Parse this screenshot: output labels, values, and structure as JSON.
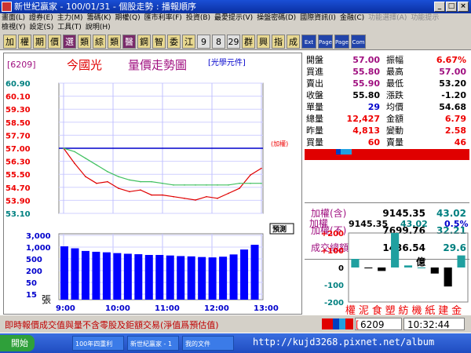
{
  "window": {
    "title": "新世紀贏家 - 100/01/31 - 個股走勢 : 播報順序"
  },
  "menu": {
    "row1": [
      "畫面(L)",
      "證券(E)",
      "主力(M)",
      "籌碼(K)",
      "期權(Q)",
      "匯市利率(F)",
      "投資(B)",
      "最愛提示(V)",
      "操盤密碼(D)",
      "國際資訊(I)",
      "金融(C)",
      "功能選擇(A)"
    ],
    "row1_disabled": [
      false,
      false,
      false,
      false,
      false,
      false,
      false,
      false,
      false,
      false,
      false,
      true
    ],
    "row1_extra": "功能提示",
    "row2": [
      "檢視(Y)",
      "設定(S)",
      "工具(T)",
      "說明(H)"
    ]
  },
  "toolbar": {
    "yellow": [
      "加",
      "權",
      "期",
      "價",
      "選",
      "類",
      "綜",
      "類",
      "醫",
      "鋼",
      "智",
      "委",
      "江"
    ],
    "numbers": [
      "9",
      "8",
      "29"
    ],
    "after_numbers": [
      "群",
      "興",
      "指",
      "成"
    ],
    "small": [
      "Ext",
      "Page Up",
      "Page Down",
      "Com"
    ]
  },
  "chart": {
    "code": "[6209]",
    "name": "今國光",
    "title": "量價走勢圖",
    "sector": "[光學元件]",
    "ref_label": "(加權)",
    "btn_label": "預測",
    "vol_unit": "張",
    "price_ticks": [
      "60.90",
      "60.10",
      "59.30",
      "58.50",
      "57.70",
      "57.00",
      "56.30",
      "55.50",
      "54.70",
      "53.90",
      "53.10"
    ],
    "vol_ticks": [
      "3,000",
      "1,000",
      "500",
      "200",
      "50",
      "15"
    ],
    "time_ticks": [
      "9:00",
      "10:00",
      "11:00",
      "12:00",
      "13:00"
    ],
    "colors": {
      "price": "#e00000",
      "avg": "#40c060",
      "ref": "#0000cc",
      "vol": "#0000ff"
    }
  },
  "chart_data": {
    "type": "line",
    "x": [
      "9:00",
      "9:15",
      "9:30",
      "9:45",
      "10:00",
      "10:15",
      "10:30",
      "10:45",
      "11:00",
      "11:15",
      "11:30",
      "11:45",
      "12:00",
      "12:15",
      "12:30",
      "12:45",
      "13:00",
      "13:15",
      "13:30"
    ],
    "series": [
      {
        "values": [
          57.0,
          56.1,
          55.3,
          54.9,
          55.0,
          54.6,
          54.4,
          54.5,
          54.2,
          54.2,
          54.1,
          54.0,
          53.9,
          54.1,
          54.0,
          54.3,
          54.6,
          55.4,
          55.8
        ]
      },
      {
        "values": [
          57.0,
          56.8,
          56.4,
          56.0,
          55.6,
          55.3,
          55.1,
          55.0,
          55.0,
          54.9,
          54.8,
          54.8,
          54.8,
          54.8,
          54.8,
          54.8,
          54.9,
          54.9,
          54.9
        ]
      }
    ],
    "volume": [
      900,
      700,
      500,
      450,
      420,
      380,
      350,
      330,
      300,
      300,
      280,
      260,
      250,
      230,
      220,
      240,
      320,
      600,
      1100
    ],
    "ref_price": 57.0
  },
  "quote": {
    "rows": [
      {
        "l1": "開盤",
        "v1": "57.00",
        "c1": "pur",
        "l2": "振幅",
        "v2": "6.67%",
        "c2": "red"
      },
      {
        "l1": "買進",
        "v1": "55.80",
        "c1": "pur",
        "l2": "最高",
        "v2": "57.00",
        "c2": "pur"
      },
      {
        "l1": "賣出",
        "v1": "55.90",
        "c1": "pur",
        "l2": "最低",
        "v2": "53.20",
        "c2": "blk"
      },
      {
        "l1": "收盤",
        "v1": "55.80",
        "c1": "blk",
        "l2": "漲跌",
        "v2": "-1.20",
        "c2": "blk"
      },
      {
        "l1": "單量",
        "v1": "29",
        "c1": "blu",
        "l2": "均價",
        "v2": "54.68",
        "c2": "blk"
      },
      {
        "l1": "總量",
        "v1": "12,427",
        "c1": "red",
        "l2": "金額",
        "v2": "6.79",
        "c2": "red"
      },
      {
        "l1": "昨量",
        "v1": "4,813",
        "c1": "red",
        "l2": "變動",
        "v2": "2.58",
        "c2": "red"
      },
      {
        "l1": "買量",
        "v1": "60",
        "c1": "red",
        "l2": "賣量",
        "v2": "46",
        "c2": "red"
      }
    ]
  },
  "index": {
    "rows": [
      {
        "label": "加權(含)",
        "val": "9145.35",
        "chg": "43.02"
      },
      {
        "label": "加權(不)",
        "val": "7699.76",
        "chg": "32.21"
      },
      {
        "label": "成交總額",
        "val": "1436.54億",
        "chg": "29.6"
      }
    ]
  },
  "sector": {
    "label": "加權",
    "val": "9145.35",
    "chg": "43.02",
    "pct": "0.5%",
    "yticks": [
      "+200",
      "+100",
      "0",
      "-100",
      "-200"
    ],
    "names": [
      "權",
      "泥",
      "食",
      "塑",
      "紡",
      "機",
      "紙",
      "建",
      "金"
    ],
    "values": [
      50,
      -5,
      -20,
      200,
      12,
      0,
      -35,
      -110,
      70
    ]
  },
  "status": {
    "message": "即時報價成交值與量不含零股及鉅額交易(淨值爲預估值)",
    "code": "6209",
    "time": "10:32:44"
  },
  "taskbar": {
    "start": "開始",
    "tasks": [
      "100年四重利",
      "新世紀贏家 - 1",
      "我的文件"
    ],
    "watermark": "http://kujd3268.pixnet.net/album"
  }
}
